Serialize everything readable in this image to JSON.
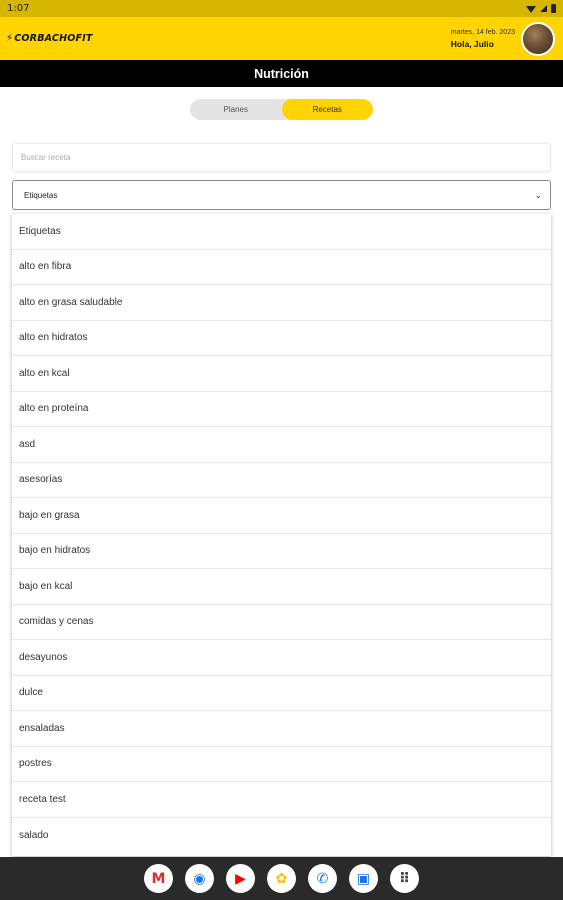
{
  "status_bar": {
    "time": "1:07"
  },
  "header": {
    "logo_text": "CORBACHOFIT",
    "date": "martes, 14 feb. 2023",
    "greeting": "Hola, Julio"
  },
  "page": {
    "title": "Nutrición"
  },
  "tabs": [
    {
      "label": "Planes",
      "active": false
    },
    {
      "label": "Recetas",
      "active": true
    }
  ],
  "search": {
    "placeholder": "Buscar receta",
    "value": ""
  },
  "tag_select": {
    "selected": "Etiquetas",
    "options": [
      "Etiquetas",
      "alto en fibra",
      "alto en grasa saludable",
      "alto en hidratos",
      "alto en kcal",
      "alto en proteína",
      "asd",
      "asesorías",
      "bajo en grasa",
      "bajo en hidratos",
      "bajo en kcal",
      "comidas y cenas",
      "desayunos",
      "dulce",
      "ensaladas",
      "postres",
      "receta test",
      "salado"
    ]
  },
  "dock": [
    {
      "icon": "gmail-icon",
      "glyph": "M",
      "color": "#d93025"
    },
    {
      "icon": "chrome-icon",
      "glyph": "◉",
      "color": "#1a73e8"
    },
    {
      "icon": "youtube-icon",
      "glyph": "▶",
      "color": "#ff0000"
    },
    {
      "icon": "photos-icon",
      "glyph": "✿",
      "color": "#fbbc04"
    },
    {
      "icon": "phone-icon",
      "glyph": "✆",
      "color": "#1a73e8"
    },
    {
      "icon": "messages-icon",
      "glyph": "▣",
      "color": "#1a73e8"
    },
    {
      "icon": "app-drawer-icon",
      "glyph": "⠿",
      "color": "#3c4043"
    }
  ]
}
